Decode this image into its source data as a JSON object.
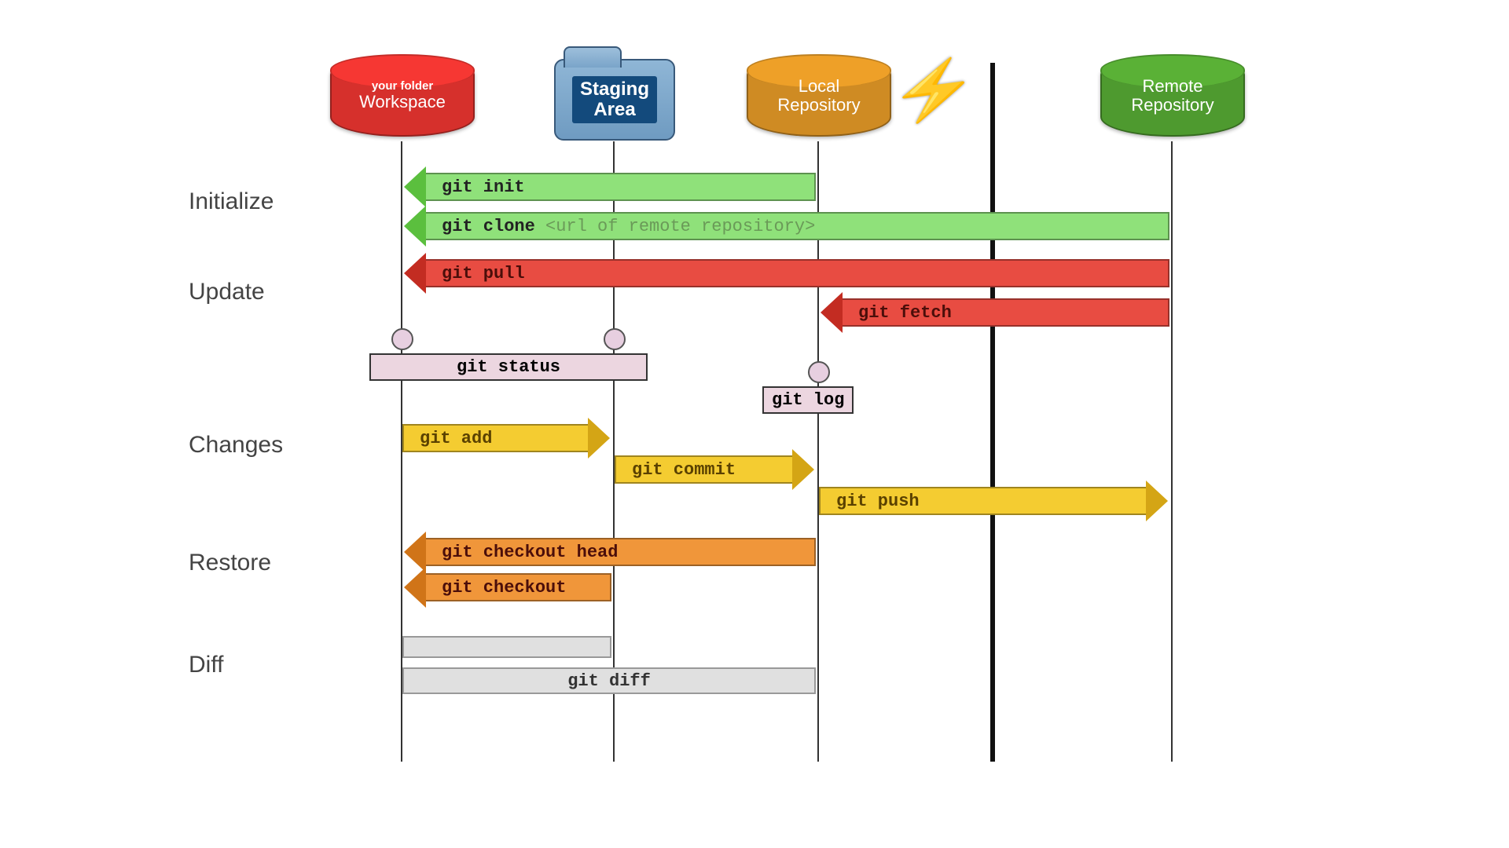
{
  "nodes": {
    "workspace": {
      "title": "Workspace",
      "subtitle": "your folder"
    },
    "staging": {
      "title": "Staging\nArea"
    },
    "local": {
      "title": "Local\nRepository"
    },
    "remote": {
      "title": "Remote\nRepository"
    }
  },
  "sections": {
    "initialize": "Initialize",
    "update": "Update",
    "changes": "Changes",
    "restore": "Restore",
    "diff": "Diff"
  },
  "commands": {
    "init": "git init",
    "clone": "git clone",
    "clone_arg": "<url of remote repository>",
    "pull": "git pull",
    "fetch": "git fetch",
    "status": "git status",
    "log": "git log",
    "add": "git add",
    "commit": "git commit",
    "push": "git push",
    "checkout_head": "git checkout head",
    "checkout": "git checkout",
    "diff": "git diff"
  }
}
